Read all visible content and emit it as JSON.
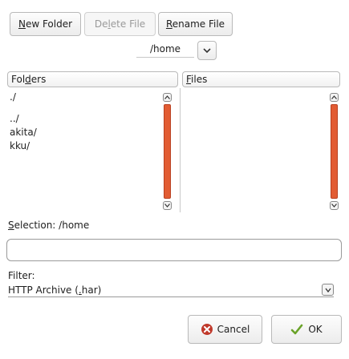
{
  "toolbar": {
    "new_folder": {
      "pre": "",
      "u": "N",
      "post": "ew Folder"
    },
    "delete_file": {
      "pre": "De",
      "u": "l",
      "post": "ete File"
    },
    "rename_file": {
      "pre": "",
      "u": "R",
      "post": "ename File"
    }
  },
  "path": {
    "current": "/home"
  },
  "folders": {
    "header": {
      "pre": "Fol",
      "u": "d",
      "post": "ers"
    },
    "items": [
      "./",
      "../",
      "akita/",
      "kku/"
    ]
  },
  "files": {
    "header": {
      "pre": "",
      "u": "F",
      "post": "iles"
    },
    "items": []
  },
  "selection": {
    "label_pre": "",
    "label_u": "S",
    "label_post": "election: /home",
    "value": ""
  },
  "filter": {
    "label_pre": "Filter",
    "label_u": "",
    "label_post": ":",
    "value_pre": "HTTP Archive (",
    "value_u": ".",
    "value_post": "har)"
  },
  "actions": {
    "cancel": "Cancel",
    "ok": "OK"
  },
  "colors": {
    "scroll_thumb": "#e25c33",
    "cancel_icon": "#c0392b",
    "ok_icon": "#6aa329"
  }
}
